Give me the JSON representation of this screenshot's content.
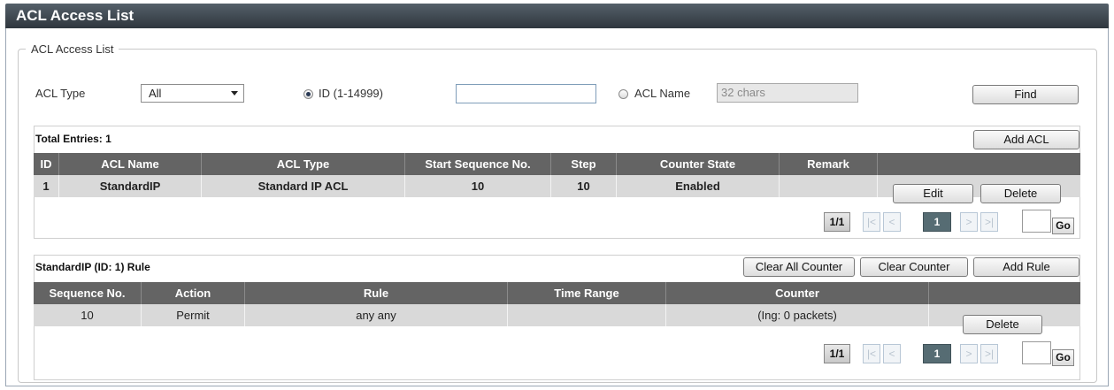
{
  "window": {
    "title": "ACL Access List"
  },
  "group": {
    "legend": "ACL Access List"
  },
  "filter": {
    "acl_type_label": "ACL Type",
    "acl_type_value": "All",
    "id_radio_label": "ID (1-14999)",
    "id_value": "",
    "name_radio_label": "ACL Name",
    "name_placeholder": "32 chars",
    "find_label": "Find"
  },
  "acl_section": {
    "total_label": "Total Entries: 1",
    "add_label": "Add ACL",
    "columns": [
      "ID",
      "ACL Name",
      "ACL Type",
      "Start Sequence No.",
      "Step",
      "Counter State",
      "Remark",
      ""
    ],
    "rows": [
      {
        "id": "1",
        "name": "StandardIP",
        "type": "Standard IP ACL",
        "start_seq": "10",
        "step": "10",
        "counter_state": "Enabled",
        "remark": "",
        "edit_label": "Edit",
        "delete_label": "Delete"
      }
    ],
    "pagination": {
      "total": "1/1",
      "first": "|<",
      "prev": "<",
      "current": "1",
      "next": ">",
      "last": ">|",
      "go_label": "Go"
    }
  },
  "rule_section": {
    "title": "StandardIP (ID: 1) Rule",
    "clear_all_label": "Clear All Counter",
    "clear_label": "Clear Counter",
    "add_label": "Add Rule",
    "columns": [
      "Sequence No.",
      "Action",
      "Rule",
      "Time Range",
      "Counter",
      ""
    ],
    "rows": [
      {
        "seq": "10",
        "action": "Permit",
        "rule": "any any",
        "time_range": "",
        "counter": "(Ing: 0 packets)",
        "delete_label": "Delete"
      }
    ],
    "pagination": {
      "total": "1/1",
      "first": "|<",
      "prev": "<",
      "current": "1",
      "next": ">",
      "last": ">|",
      "go_label": "Go"
    }
  }
}
